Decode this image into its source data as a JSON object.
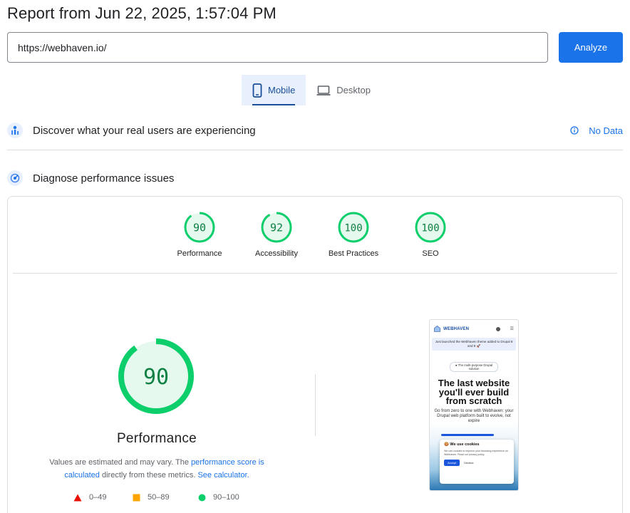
{
  "header": {
    "title": "Report from Jun 22, 2025, 1:57:04 PM"
  },
  "url_bar": {
    "value": "https://webhaven.io/",
    "analyze_label": "Analyze"
  },
  "device_tabs": [
    {
      "label": "Mobile",
      "active": true
    },
    {
      "label": "Desktop",
      "active": false
    }
  ],
  "crux": {
    "title": "Discover what your real users are experiencing",
    "status": "No Data"
  },
  "diagnose": {
    "title": "Diagnose performance issues"
  },
  "scores": [
    {
      "label": "Performance",
      "value": 90
    },
    {
      "label": "Accessibility",
      "value": 92
    },
    {
      "label": "Best Practices",
      "value": 100
    },
    {
      "label": "SEO",
      "value": 100
    }
  ],
  "performance": {
    "score": 90,
    "title": "Performance",
    "note_prefix": "Values are estimated and may vary. The ",
    "note_link1": "performance score is calculated",
    "note_middle": " directly from these metrics. ",
    "note_link2": "See calculator."
  },
  "legend": [
    {
      "range": "0–49",
      "color": "#eb0f00",
      "shape": "triangle"
    },
    {
      "range": "50–89",
      "color": "#ffa400",
      "shape": "square"
    },
    {
      "range": "90–100",
      "color": "#0cce6b",
      "shape": "circle"
    }
  ],
  "colors": {
    "pass": "#0cce6b",
    "pass_text": "#0d8042",
    "pass_bg": "#e6f9ee",
    "accent": "#1a73e8"
  },
  "thumbnail": {
    "logo": "WEBHAVEN",
    "banner": "Just launched the Webhaven theme added to Drupal 8 and 9 🚀",
    "pill": "● The multi-purpose Drupal solution",
    "headline": "The last website you'll ever build from scratch",
    "subtext": "Go from zero to one with Webhaven: your Drupal web platform built to evolve, not expire",
    "cookie_title": "We use cookies",
    "cookie_text": "We use cookies to improve your browsing experience on Webhaven. Read our privacy policy.",
    "cookie_accept": "Accept",
    "cookie_decline": "Decline"
  }
}
